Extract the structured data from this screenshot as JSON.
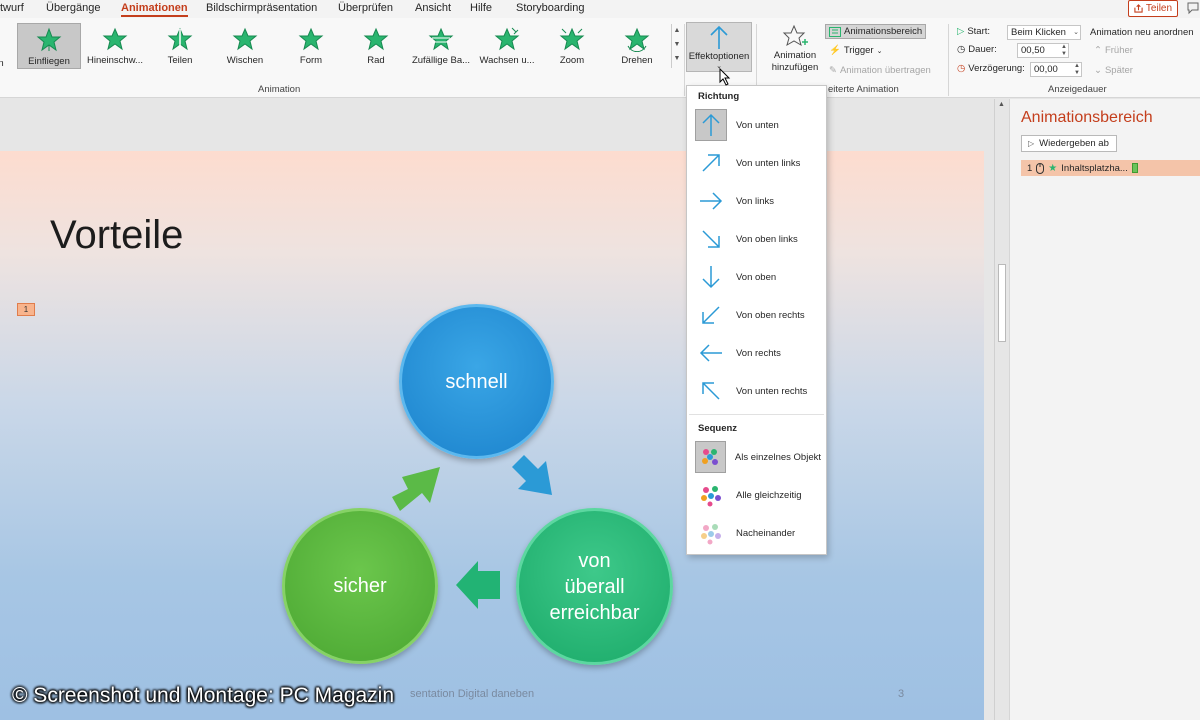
{
  "tabs": [
    {
      "label": "twurf"
    },
    {
      "label": "Übergänge"
    },
    {
      "label": "Animationen",
      "active": true
    },
    {
      "label": "Bildschirmpräsentation"
    },
    {
      "label": "Überprüfen"
    },
    {
      "label": "Ansicht"
    },
    {
      "label": "Hilfe"
    },
    {
      "label": "Storyboarding"
    }
  ],
  "share": {
    "label": "Teilen"
  },
  "animation_gallery": {
    "partial_left_label": "n",
    "items": [
      {
        "label": "Einfliegen",
        "selected": true
      },
      {
        "label": "Hineinschw..."
      },
      {
        "label": "Teilen"
      },
      {
        "label": "Wischen"
      },
      {
        "label": "Form"
      },
      {
        "label": "Rad"
      },
      {
        "label": "Zufällige Ba..."
      },
      {
        "label": "Wachsen u..."
      },
      {
        "label": "Zoom"
      },
      {
        "label": "Drehen"
      }
    ],
    "group_label": "Animation"
  },
  "effect_options": {
    "label": "Effektoptionen"
  },
  "advanced_animation": {
    "add_animation_label_1": "Animation",
    "add_animation_label_2": "hinzufügen",
    "animation_pane_label": "Animationsbereich",
    "trigger_label": "Trigger",
    "copy_animation_label": "Animation übertragen",
    "group_label": "eiterte Animation"
  },
  "timing": {
    "start_label": "Start:",
    "start_value": "Beim Klicken",
    "duration_label": "Dauer:",
    "duration_value": "00,50",
    "delay_label": "Verzögerung:",
    "delay_value": "00,00",
    "reorder_label": "Animation neu anordnen",
    "earlier_label": "Früher",
    "later_label": "Später",
    "group_label": "Anzeigedauer"
  },
  "dropdown": {
    "direction_header": "Richtung",
    "directions": [
      {
        "label": "Von unten",
        "icon": "arrow-up-icon",
        "selected": true
      },
      {
        "label": "Von unten links",
        "icon": "arrow-up-right-icon"
      },
      {
        "label": "Von links",
        "icon": "arrow-right-icon"
      },
      {
        "label": "Von oben links",
        "icon": "arrow-down-right-icon"
      },
      {
        "label": "Von oben",
        "icon": "arrow-down-icon"
      },
      {
        "label": "Von oben rechts",
        "icon": "arrow-down-left-icon"
      },
      {
        "label": "Von rechts",
        "icon": "arrow-left-icon"
      },
      {
        "label": "Von unten rechts",
        "icon": "arrow-up-left-icon"
      }
    ],
    "sequence_header": "Sequenz",
    "sequences": [
      {
        "label": "Als einzelnes Objekt",
        "selected": true
      },
      {
        "label": "Alle gleichzeitig"
      },
      {
        "label": "Nacheinander"
      }
    ]
  },
  "slide": {
    "title": "Vorteile",
    "animation_tag": "1",
    "circles": {
      "schnell": "schnell",
      "sicher": "sicher",
      "ueberall_1": "von",
      "ueberall_2": "überall",
      "ueberall_3": "erreichbar"
    },
    "footer": "sentation Digital daneben",
    "number": "3",
    "colors": {
      "blue": "#1b82cc",
      "green": "#4aa631",
      "teal": "#1aa968"
    }
  },
  "animation_pane": {
    "title": "Animationsbereich",
    "play_from": "Wiedergeben ab",
    "item_number": "1",
    "item_label": "Inhaltsplatzha..."
  },
  "watermark": "© Screenshot und Montage: PC Magazin",
  "accent_color": "#c43e1c"
}
